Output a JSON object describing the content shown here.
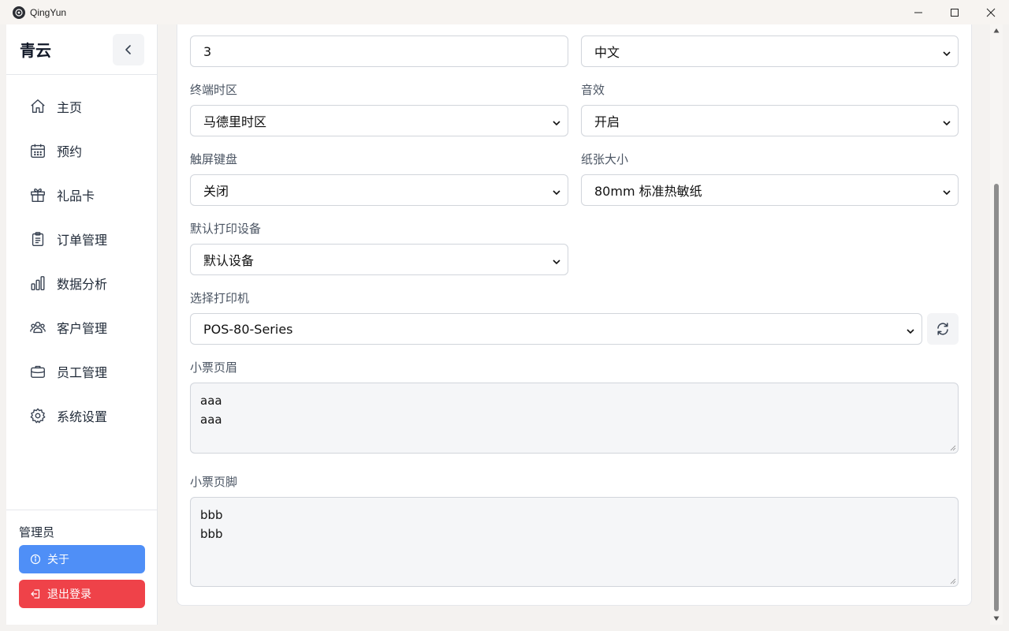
{
  "window": {
    "title": "QingYun",
    "minimize_icon": "minimize-icon",
    "maximize_icon": "maximize-icon",
    "close_icon": "close-icon"
  },
  "sidebar": {
    "title": "青云",
    "items": [
      {
        "label": "主页",
        "icon": "home-icon"
      },
      {
        "label": "预约",
        "icon": "calendar-icon"
      },
      {
        "label": "礼品卡",
        "icon": "gift-icon"
      },
      {
        "label": "订单管理",
        "icon": "clipboard-icon"
      },
      {
        "label": "数据分析",
        "icon": "bar-chart-icon"
      },
      {
        "label": "客户管理",
        "icon": "users-icon"
      },
      {
        "label": "员工管理",
        "icon": "briefcase-icon"
      },
      {
        "label": "系统设置",
        "icon": "gear-icon"
      }
    ],
    "user": "管理员",
    "about_label": "关于",
    "logout_label": "退出登录"
  },
  "settings": {
    "top_left_value": "3",
    "language_value": "中文",
    "timezone": {
      "label": "终端时区",
      "value": "马德里时区"
    },
    "sound": {
      "label": "音效",
      "value": "开启"
    },
    "touch_keyboard": {
      "label": "触屏键盘",
      "value": "关闭"
    },
    "paper_size": {
      "label": "纸张大小",
      "value": "80mm 标准热敏纸"
    },
    "default_printer": {
      "label": "默认打印设备",
      "value": "默认设备"
    },
    "printer": {
      "label": "选择打印机",
      "value": "POS-80-Series"
    },
    "receipt_header": {
      "label": "小票页眉",
      "lines": [
        "aaa",
        "aaa"
      ]
    },
    "receipt_footer": {
      "label": "小票页脚",
      "lines": [
        "bbb",
        "bbb"
      ]
    }
  },
  "colors": {
    "about_button": "#4f8ff7",
    "logout_button": "#ef4249"
  }
}
